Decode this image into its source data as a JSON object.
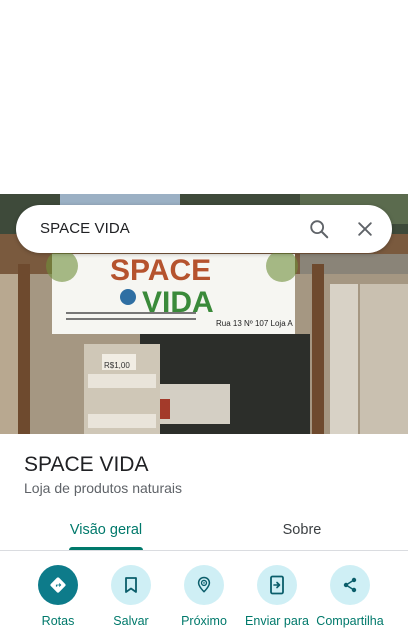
{
  "search": {
    "query": "SPACE VIDA"
  },
  "storefront": {
    "sign_top": "SPACE",
    "sign_bottom": "VIDA",
    "sign_address": "Rua 13 Nº 107 Loja A",
    "price_tag": "R$1,00"
  },
  "place": {
    "name": "SPACE VIDA",
    "category": "Loja de produtos naturais"
  },
  "tabs": [
    {
      "label": "Visão geral",
      "active": true
    },
    {
      "label": "Sobre",
      "active": false
    }
  ],
  "actions": [
    {
      "label": "Rotas",
      "icon": "directions-icon"
    },
    {
      "label": "Salvar",
      "icon": "bookmark-icon"
    },
    {
      "label": "Próximo",
      "icon": "nearby-icon"
    },
    {
      "label": "Enviar para",
      "icon": "send-to-phone-icon"
    },
    {
      "label": "Compartilha",
      "icon": "share-icon"
    }
  ],
  "colors": {
    "accent": "#00796b",
    "action_bg": "#cfeff5",
    "primary_action_bg": "#0d7b8a"
  }
}
